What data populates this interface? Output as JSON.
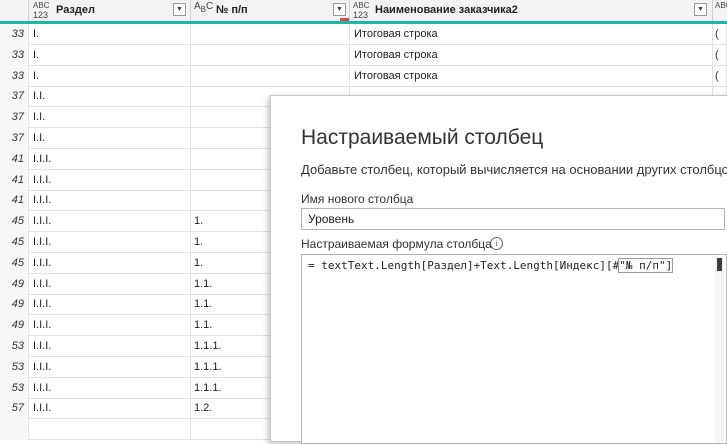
{
  "columns": [
    {
      "type_top": "ABC",
      "type_bottom": "123",
      "label": "Раздел"
    },
    {
      "type_top": "A",
      "type_bottom": "B",
      "type_sub": "C",
      "label": "№ п/п"
    },
    {
      "type_top": "ABC",
      "type_bottom": "123",
      "label": "Наименование заказчика2"
    }
  ],
  "rows": [
    {
      "idx": "33",
      "razdel": "I.",
      "npp": "",
      "name": "Итоговая строка",
      "extra": "("
    },
    {
      "idx": "33",
      "razdel": "I.",
      "npp": "",
      "name": "Итоговая строка",
      "extra": "("
    },
    {
      "idx": "33",
      "razdel": "I.",
      "npp": "",
      "name": "Итоговая строка",
      "extra": "("
    },
    {
      "idx": "37",
      "razdel": "I.I.",
      "npp": "",
      "name": "",
      "extra": ""
    },
    {
      "idx": "37",
      "razdel": "I.I.",
      "npp": "",
      "name": "",
      "extra": ""
    },
    {
      "idx": "37",
      "razdel": "I.I.",
      "npp": "",
      "name": "",
      "extra": ""
    },
    {
      "idx": "41",
      "razdel": "I.I.I.",
      "npp": "",
      "name": "",
      "extra": ""
    },
    {
      "idx": "41",
      "razdel": "I.I.I.",
      "npp": "",
      "name": "",
      "extra": ""
    },
    {
      "idx": "41",
      "razdel": "I.I.I.",
      "npp": "",
      "name": "",
      "extra": ""
    },
    {
      "idx": "45",
      "razdel": "I.I.I.",
      "npp": "1.",
      "name": "",
      "extra": ""
    },
    {
      "idx": "45",
      "razdel": "I.I.I.",
      "npp": "1.",
      "name": "",
      "extra": ""
    },
    {
      "idx": "45",
      "razdel": "I.I.I.",
      "npp": "1.",
      "name": "",
      "extra": ""
    },
    {
      "idx": "49",
      "razdel": "I.I.I.",
      "npp": "1.1.",
      "name": "",
      "extra": ""
    },
    {
      "idx": "49",
      "razdel": "I.I.I.",
      "npp": "1.1.",
      "name": "",
      "extra": ""
    },
    {
      "idx": "49",
      "razdel": "I.I.I.",
      "npp": "1.1.",
      "name": "",
      "extra": ""
    },
    {
      "idx": "53",
      "razdel": "I.I.I.",
      "npp": "1.1.1.",
      "name": "",
      "extra": ""
    },
    {
      "idx": "53",
      "razdel": "I.I.I.",
      "npp": "1.1.1.",
      "name": "",
      "extra": ""
    },
    {
      "idx": "53",
      "razdel": "I.I.I.",
      "npp": "1.1.1.",
      "name": "",
      "extra": ""
    },
    {
      "idx": "57",
      "razdel": "I.I.I.",
      "npp": "1.2.",
      "name": "",
      "extra": ""
    },
    {
      "idx": "",
      "razdel": "",
      "npp": "",
      "name": "",
      "extra": ""
    }
  ],
  "dialog": {
    "title": "Настраиваемый столбец",
    "description": "Добавьте столбец, который вычисляется на основании других столбцов.",
    "name_label": "Имя нового столбца",
    "name_value": "Уровень",
    "formula_label": "Настраиваемая формула столбца",
    "formula": "= textText.Length[Раздел]+Text.Length[Индекс][#\"№ п/п\"]"
  },
  "colors": {
    "accent": "#22b3a3",
    "header_bg": "#f3f3f3",
    "flag": "#d24b4b"
  }
}
